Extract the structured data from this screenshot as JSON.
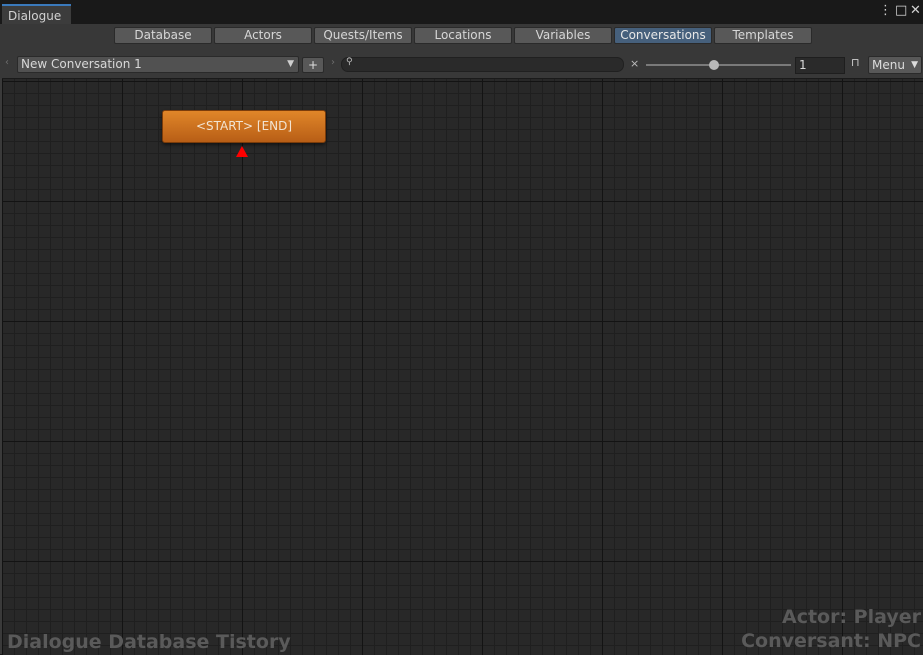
{
  "window": {
    "title": "Dialogue",
    "controls": {
      "more_icon": "⋮",
      "maximize_icon": "□",
      "close_icon": "✕"
    }
  },
  "tabs": [
    {
      "label": "Database",
      "active": false
    },
    {
      "label": "Actors",
      "active": false
    },
    {
      "label": "Quests/Items",
      "active": false
    },
    {
      "label": "Locations",
      "active": false
    },
    {
      "label": "Variables",
      "active": false
    },
    {
      "label": "Conversations",
      "active": true
    },
    {
      "label": "Templates",
      "active": false
    }
  ],
  "toolbar": {
    "prev_arrow": "‹",
    "next_arrow": "›",
    "conversation_selected": "New Conversation 1",
    "add_label": "+",
    "search_value": "",
    "clear_label": "×",
    "zoom_value": "1",
    "menu_label": "Menu"
  },
  "canvas": {
    "node_label": "<START> [END]",
    "node_color": "#d0741f",
    "marker_color": "#ff0000"
  },
  "overlay": {
    "database_name": "Dialogue Database Tistory",
    "actor": "Actor: Player",
    "conversant": "Conversant: NPC"
  },
  "colors": {
    "active_tab": "#46607c",
    "window_accent": "#3a79bb"
  }
}
